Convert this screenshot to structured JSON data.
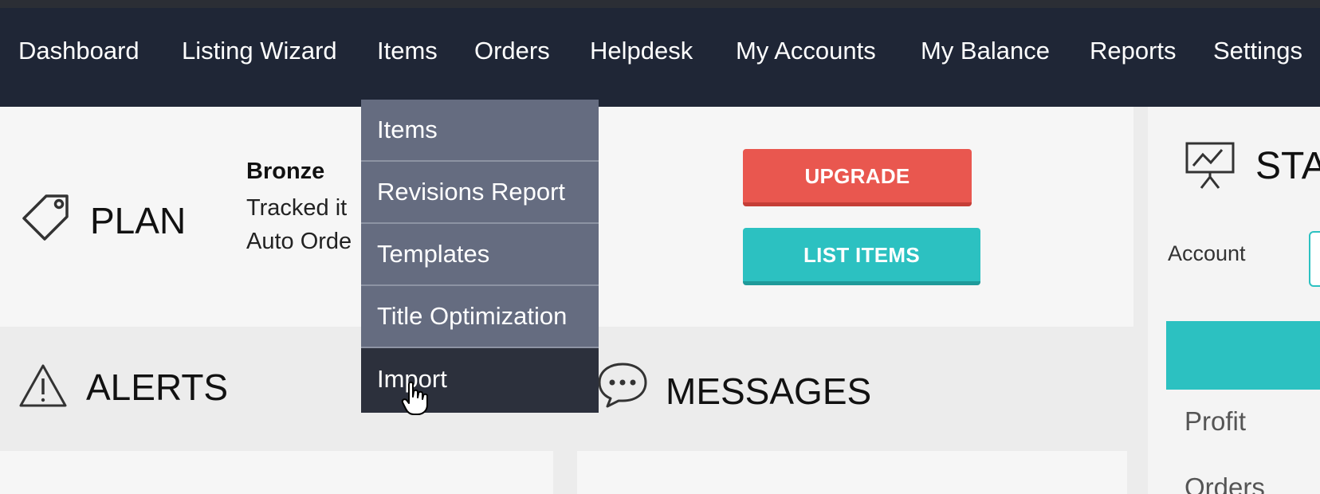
{
  "nav": {
    "items": [
      {
        "label": "Dashboard"
      },
      {
        "label": "Listing Wizard"
      },
      {
        "label": "Items"
      },
      {
        "label": "Orders"
      },
      {
        "label": "Helpdesk"
      },
      {
        "label": "My Accounts"
      },
      {
        "label": "My Balance"
      },
      {
        "label": "Reports"
      },
      {
        "label": "Settings"
      }
    ]
  },
  "dropdown": {
    "items": [
      {
        "label": "Items"
      },
      {
        "label": "Revisions Report"
      },
      {
        "label": "Templates"
      },
      {
        "label": "Title Optimization"
      },
      {
        "label": "Import"
      }
    ],
    "active_item": "Import"
  },
  "plan": {
    "title": "PLAN",
    "name": "Bronze",
    "line1": "Tracked it",
    "line2": "Auto Orde",
    "icon": "price-tag-icon"
  },
  "buttons": {
    "upgrade": "UPGRADE",
    "list_items": "LIST ITEMS",
    "upgrade_color": "#e9574f",
    "list_color": "#2cc1c1"
  },
  "stats": {
    "title": "STA",
    "account_label": "Account",
    "rows": [
      {
        "label": "Profit"
      },
      {
        "label": "Orders"
      }
    ],
    "icon": "presentation-board-icon"
  },
  "alerts": {
    "title": "ALERTS",
    "icon": "warning-triangle-icon"
  },
  "messages": {
    "title": "MESSAGES",
    "icon": "speech-bubble-icon"
  },
  "colors": {
    "navbar": "#1f2636",
    "dropdown": "#656c80",
    "dropdown_active": "#2c303c",
    "accent": "#2cc1c1"
  }
}
